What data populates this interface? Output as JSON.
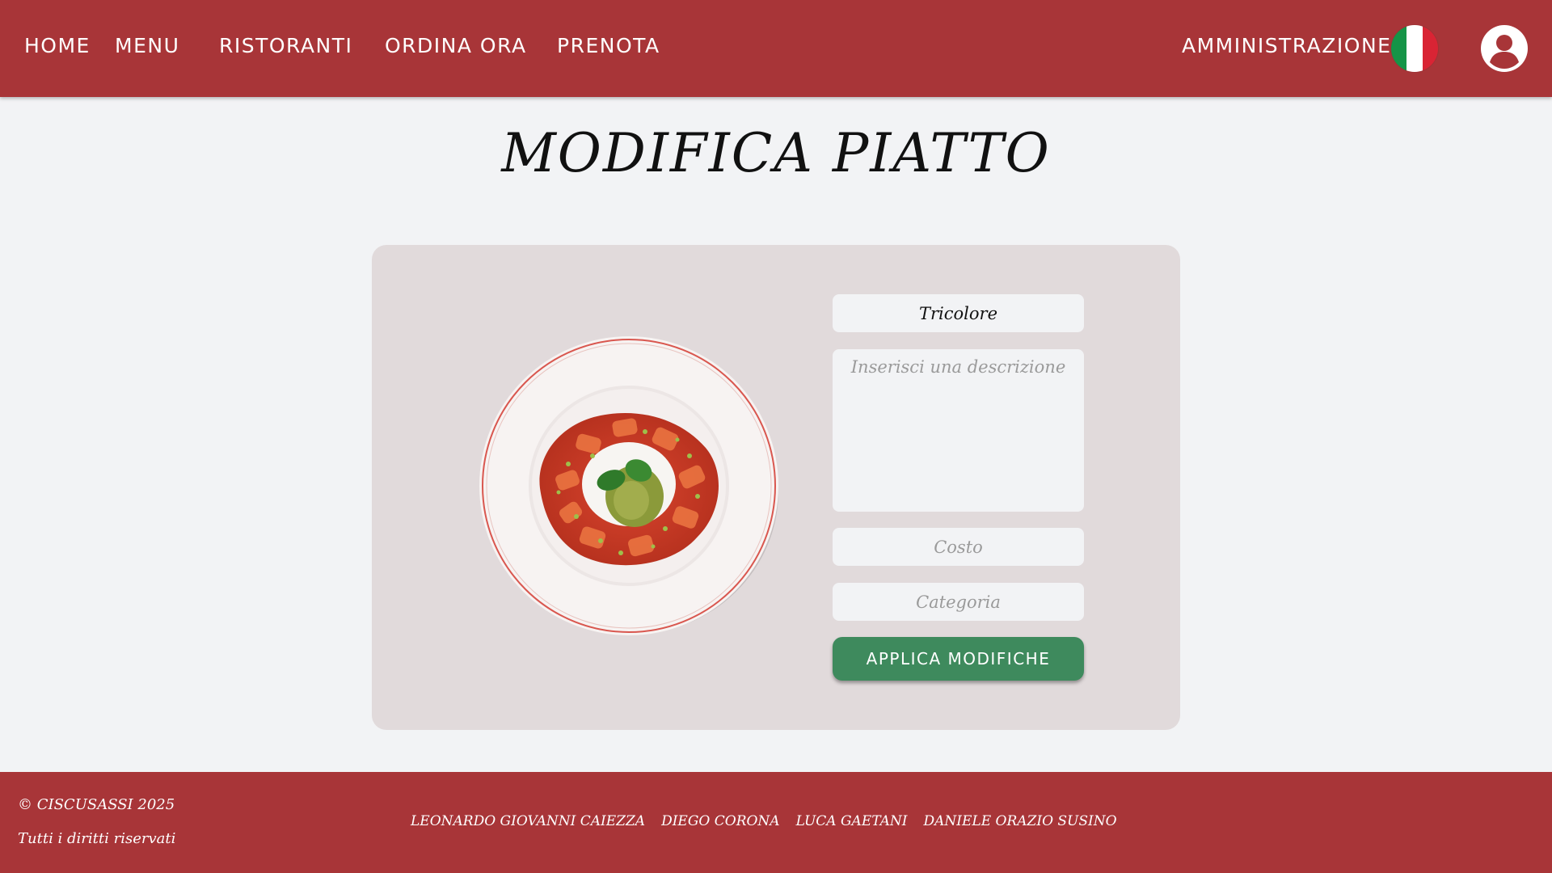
{
  "nav": {
    "items": [
      {
        "label": "HOME"
      },
      {
        "label": "MENU"
      },
      {
        "label": "RISTORANTI"
      },
      {
        "label": "ORDINA ORA"
      },
      {
        "label": "PRENOTA"
      }
    ],
    "admin_label": "AMMINISTRAZIONE",
    "flag_icon": "italy-flag-icon",
    "flag_colors": [
      "#159447",
      "#ffffff",
      "#d92434"
    ],
    "user_icon": "user-account-icon"
  },
  "page": {
    "title": "MODIFICA PIATTO"
  },
  "form": {
    "dish_image_icon": "dish-plate-image",
    "name_value": "Tricolore",
    "description_placeholder": "Inserisci una descrizione",
    "description_value": "",
    "cost_placeholder": "Costo",
    "cost_value": "",
    "category_placeholder": "Categoria",
    "category_value": "",
    "apply_label": "APPLICA MODIFICHE"
  },
  "footer": {
    "copyright": "© CISCUSASSI 2025",
    "rights": "Tutti i diritti riservati",
    "authors": [
      "LEONARDO GIOVANNI CAIEZZA",
      "DIEGO CORONA",
      "LUCA GAETANI",
      "DANIELE ORAZIO SUSINO"
    ]
  },
  "colors": {
    "brand_red": "#a83538",
    "background": "#f2f3f5",
    "card": "#e1dadb",
    "apply_green": "#3e8a5d"
  }
}
